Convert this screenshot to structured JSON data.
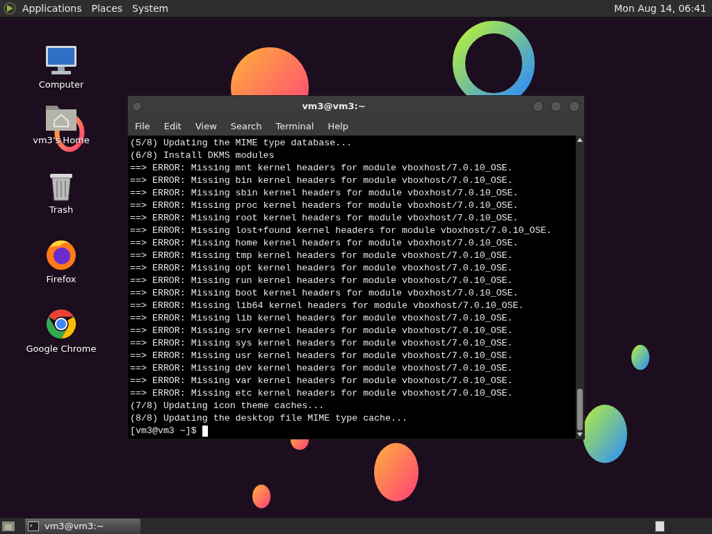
{
  "top_panel": {
    "menus": [
      "Applications",
      "Places",
      "System"
    ],
    "clock": "Mon Aug 14, 06:41"
  },
  "desktop_icons": [
    {
      "label": "Computer",
      "kind": "computer"
    },
    {
      "label": "vm3's Home",
      "kind": "home"
    },
    {
      "label": "Trash",
      "kind": "trash"
    },
    {
      "label": "Firefox",
      "kind": "firefox"
    },
    {
      "label": "Google Chrome",
      "kind": "chrome"
    }
  ],
  "terminal": {
    "title": "vm3@vm3:~",
    "menus": [
      "File",
      "Edit",
      "View",
      "Search",
      "Terminal",
      "Help"
    ],
    "lines": [
      "(5/8) Updating the MIME type database...",
      "(6/8) Install DKMS modules",
      "==> ERROR: Missing mnt kernel headers for module vboxhost/7.0.10_OSE.",
      "==> ERROR: Missing bin kernel headers for module vboxhost/7.0.10_OSE.",
      "==> ERROR: Missing sbin kernel headers for module vboxhost/7.0.10_OSE.",
      "==> ERROR: Missing proc kernel headers for module vboxhost/7.0.10_OSE.",
      "==> ERROR: Missing root kernel headers for module vboxhost/7.0.10_OSE.",
      "==> ERROR: Missing lost+found kernel headers for module vboxhost/7.0.10_OSE.",
      "==> ERROR: Missing home kernel headers for module vboxhost/7.0.10_OSE.",
      "==> ERROR: Missing tmp kernel headers for module vboxhost/7.0.10_OSE.",
      "==> ERROR: Missing opt kernel headers for module vboxhost/7.0.10_OSE.",
      "==> ERROR: Missing run kernel headers for module vboxhost/7.0.10_OSE.",
      "==> ERROR: Missing boot kernel headers for module vboxhost/7.0.10_OSE.",
      "==> ERROR: Missing lib64 kernel headers for module vboxhost/7.0.10_OSE.",
      "==> ERROR: Missing lib kernel headers for module vboxhost/7.0.10_OSE.",
      "==> ERROR: Missing srv kernel headers for module vboxhost/7.0.10_OSE.",
      "==> ERROR: Missing sys kernel headers for module vboxhost/7.0.10_OSE.",
      "==> ERROR: Missing usr kernel headers for module vboxhost/7.0.10_OSE.",
      "==> ERROR: Missing dev kernel headers for module vboxhost/7.0.10_OSE.",
      "==> ERROR: Missing var kernel headers for module vboxhost/7.0.10_OSE.",
      "==> ERROR: Missing etc kernel headers for module vboxhost/7.0.10_OSE.",
      "(7/8) Updating icon theme caches...",
      "(8/8) Updating the desktop file MIME type cache..."
    ],
    "prompt": "[vm3@vm3 ~]$"
  },
  "taskbar": {
    "tasks": [
      {
        "label": "vm3@vm3:~",
        "selected": true
      }
    ]
  }
}
